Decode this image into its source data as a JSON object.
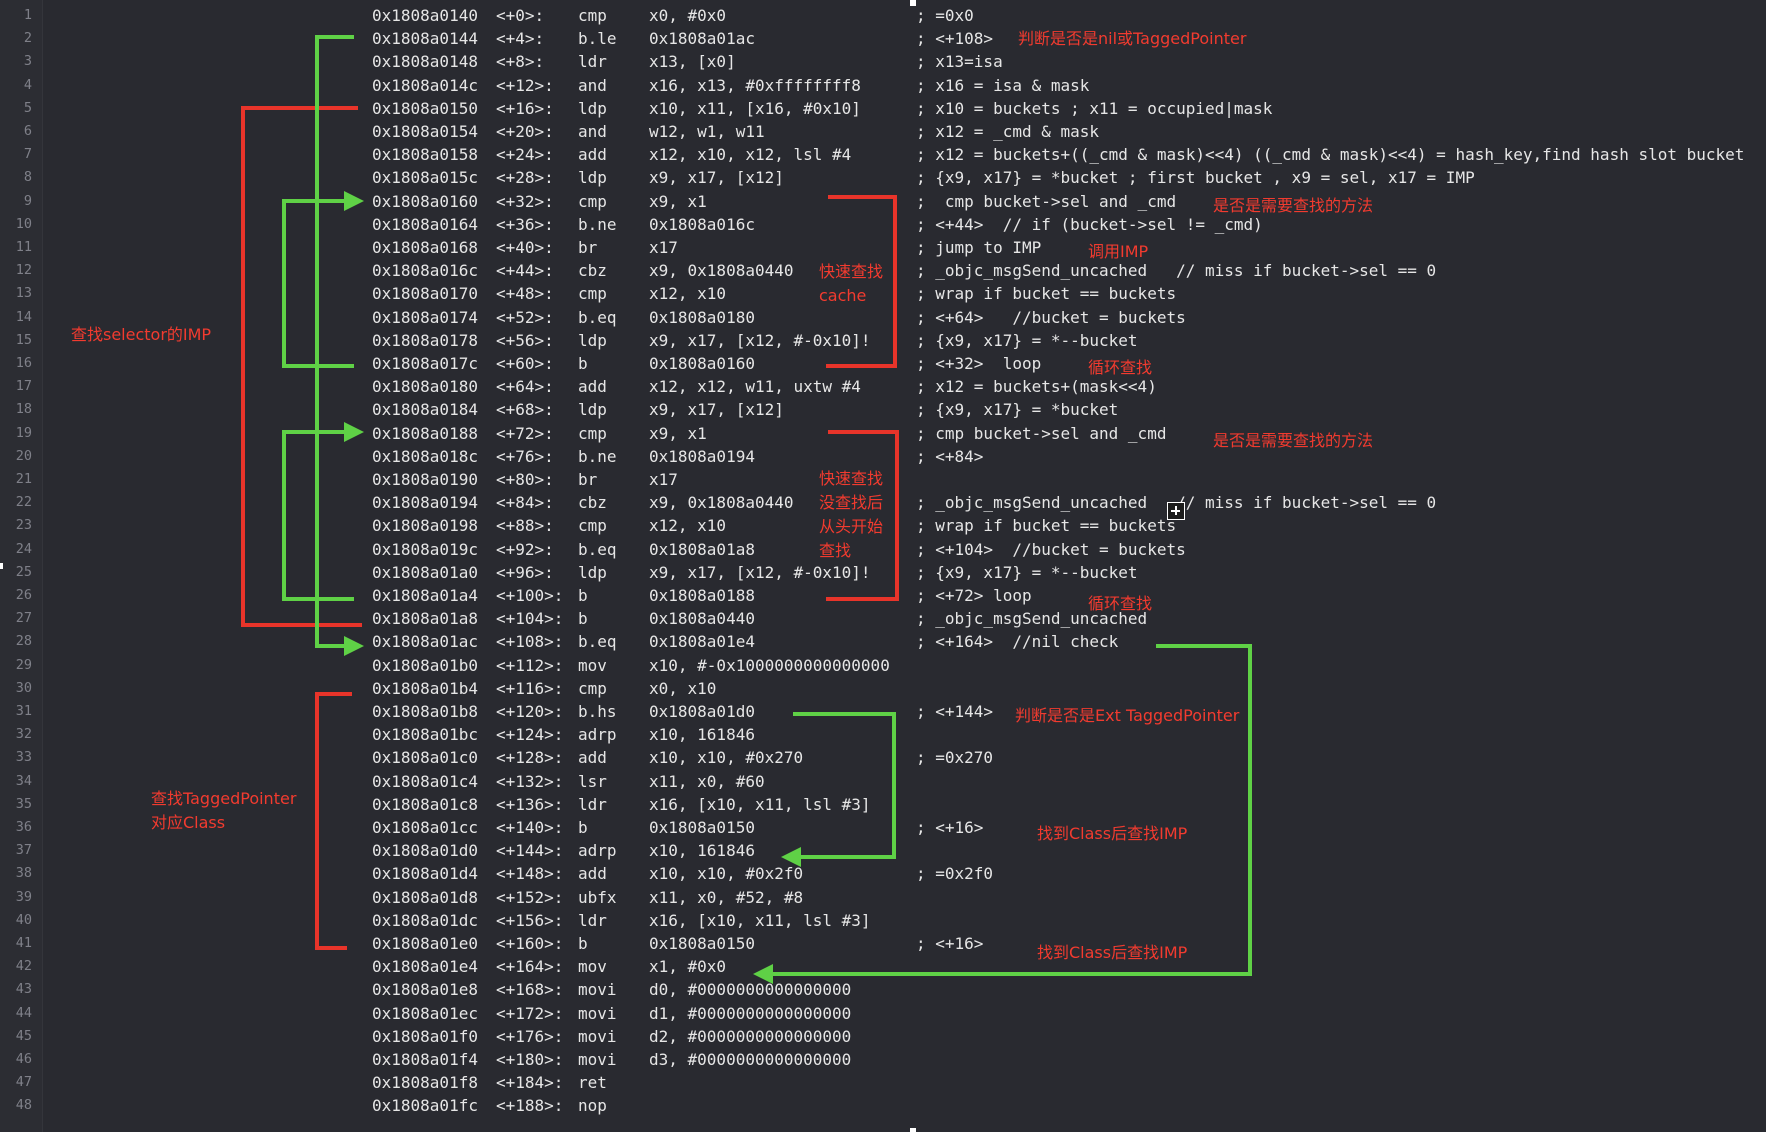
{
  "lines": [
    {
      "n": "1",
      "addr": "0x1808a0140",
      "off": "<+0>:",
      "op": "cmp",
      "args": "x0, #0x0",
      "cmt": "; =0x0"
    },
    {
      "n": "2",
      "addr": "0x1808a0144",
      "off": "<+4>:",
      "op": "b.le",
      "args": "0x1808a01ac",
      "cmt": "; <+108>"
    },
    {
      "n": "3",
      "addr": "0x1808a0148",
      "off": "<+8>:",
      "op": "ldr",
      "args": "x13, [x0]",
      "cmt": "; x13=isa"
    },
    {
      "n": "4",
      "addr": "0x1808a014c",
      "off": "<+12>:",
      "op": "and",
      "args": "x16, x13, #0xffffffff8",
      "cmt": "; x16 = isa & mask"
    },
    {
      "n": "5",
      "addr": "0x1808a0150",
      "off": "<+16>:",
      "op": "ldp",
      "args": "x10, x11, [x16, #0x10]",
      "cmt": "; x10 = buckets ; x11 = occupied|mask"
    },
    {
      "n": "6",
      "addr": "0x1808a0154",
      "off": "<+20>:",
      "op": "and",
      "args": "w12, w1, w11",
      "cmt": "; x12 = _cmd & mask"
    },
    {
      "n": "7",
      "addr": "0x1808a0158",
      "off": "<+24>:",
      "op": "add",
      "args": "x12, x10, x12, lsl #4",
      "cmt": "; x12 = buckets+((_cmd & mask)<<4) ((_cmd & mask)<<4) = hash_key,find hash slot bucket"
    },
    {
      "n": "8",
      "addr": "0x1808a015c",
      "off": "<+28>:",
      "op": "ldp",
      "args": "x9, x17, [x12]",
      "cmt": "; {x9, x17} = *bucket ; first bucket , x9 = sel, x17 = IMP"
    },
    {
      "n": "9",
      "addr": "0x1808a0160",
      "off": "<+32>:",
      "op": "cmp",
      "args": "x9, x1",
      "cmt": ";  cmp bucket->sel and _cmd"
    },
    {
      "n": "10",
      "addr": "0x1808a0164",
      "off": "<+36>:",
      "op": "b.ne",
      "args": "0x1808a016c",
      "cmt": "; <+44>  // if (bucket->sel != _cmd)"
    },
    {
      "n": "11",
      "addr": "0x1808a0168",
      "off": "<+40>:",
      "op": "br",
      "args": "x17",
      "cmt": "; jump to IMP"
    },
    {
      "n": "12",
      "addr": "0x1808a016c",
      "off": "<+44>:",
      "op": "cbz",
      "args": "x9, 0x1808a0440",
      "cmt": "; _objc_msgSend_uncached   // miss if bucket->sel == 0"
    },
    {
      "n": "13",
      "addr": "0x1808a0170",
      "off": "<+48>:",
      "op": "cmp",
      "args": "x12, x10",
      "cmt": "; wrap if bucket == buckets"
    },
    {
      "n": "14",
      "addr": "0x1808a0174",
      "off": "<+52>:",
      "op": "b.eq",
      "args": "0x1808a0180",
      "cmt": "; <+64>   //bucket = buckets"
    },
    {
      "n": "15",
      "addr": "0x1808a0178",
      "off": "<+56>:",
      "op": "ldp",
      "args": "x9, x17, [x12, #-0x10]!",
      "cmt": "; {x9, x17} = *--bucket"
    },
    {
      "n": "16",
      "addr": "0x1808a017c",
      "off": "<+60>:",
      "op": "b",
      "args": "0x1808a0160",
      "cmt": "; <+32>  loop"
    },
    {
      "n": "17",
      "addr": "0x1808a0180",
      "off": "<+64>:",
      "op": "add",
      "args": "x12, x12, w11, uxtw #4",
      "cmt": "; x12 = buckets+(mask<<4)"
    },
    {
      "n": "18",
      "addr": "0x1808a0184",
      "off": "<+68>:",
      "op": "ldp",
      "args": "x9, x17, [x12]",
      "cmt": "; {x9, x17} = *bucket"
    },
    {
      "n": "19",
      "addr": "0x1808a0188",
      "off": "<+72>:",
      "op": "cmp",
      "args": "x9, x1",
      "cmt": "; cmp bucket->sel and _cmd"
    },
    {
      "n": "20",
      "addr": "0x1808a018c",
      "off": "<+76>:",
      "op": "b.ne",
      "args": "0x1808a0194",
      "cmt": "; <+84>"
    },
    {
      "n": "21",
      "addr": "0x1808a0190",
      "off": "<+80>:",
      "op": "br",
      "args": "x17",
      "cmt": ""
    },
    {
      "n": "22",
      "addr": "0x1808a0194",
      "off": "<+84>:",
      "op": "cbz",
      "args": "x9, 0x1808a0440",
      "cmt": "; _objc_msgSend_uncached   // miss if bucket->sel == 0"
    },
    {
      "n": "23",
      "addr": "0x1808a0198",
      "off": "<+88>:",
      "op": "cmp",
      "args": "x12, x10",
      "cmt": "; wrap if bucket == buckets"
    },
    {
      "n": "24",
      "addr": "0x1808a019c",
      "off": "<+92>:",
      "op": "b.eq",
      "args": "0x1808a01a8",
      "cmt": "; <+104>  //bucket = buckets"
    },
    {
      "n": "25",
      "addr": "0x1808a01a0",
      "off": "<+96>:",
      "op": "ldp",
      "args": "x9, x17, [x12, #-0x10]!",
      "cmt": "; {x9, x17} = *--bucket"
    },
    {
      "n": "26",
      "addr": "0x1808a01a4",
      "off": "<+100>:",
      "op": "b",
      "args": "0x1808a0188",
      "cmt": "; <+72> loop"
    },
    {
      "n": "27",
      "addr": "0x1808a01a8",
      "off": "<+104>:",
      "op": "b",
      "args": "0x1808a0440",
      "cmt": "; _objc_msgSend_uncached"
    },
    {
      "n": "28",
      "addr": "0x1808a01ac",
      "off": "<+108>:",
      "op": "b.eq",
      "args": "0x1808a01e4",
      "cmt": "; <+164>  //nil check"
    },
    {
      "n": "29",
      "addr": "0x1808a01b0",
      "off": "<+112>:",
      "op": "mov",
      "args": "x10, #-0x1000000000000000",
      "cmt": ""
    },
    {
      "n": "30",
      "addr": "0x1808a01b4",
      "off": "<+116>:",
      "op": "cmp",
      "args": "x0, x10",
      "cmt": ""
    },
    {
      "n": "31",
      "addr": "0x1808a01b8",
      "off": "<+120>:",
      "op": "b.hs",
      "args": "0x1808a01d0",
      "cmt": "; <+144>"
    },
    {
      "n": "32",
      "addr": "0x1808a01bc",
      "off": "<+124>:",
      "op": "adrp",
      "args": "x10, 161846",
      "cmt": ""
    },
    {
      "n": "33",
      "addr": "0x1808a01c0",
      "off": "<+128>:",
      "op": "add",
      "args": "x10, x10, #0x270",
      "cmt": "; =0x270"
    },
    {
      "n": "34",
      "addr": "0x1808a01c4",
      "off": "<+132>:",
      "op": "lsr",
      "args": "x11, x0, #60",
      "cmt": ""
    },
    {
      "n": "35",
      "addr": "0x1808a01c8",
      "off": "<+136>:",
      "op": "ldr",
      "args": "x16, [x10, x11, lsl #3]",
      "cmt": ""
    },
    {
      "n": "36",
      "addr": "0x1808a01cc",
      "off": "<+140>:",
      "op": "b",
      "args": "0x1808a0150",
      "cmt": "; <+16>"
    },
    {
      "n": "37",
      "addr": "0x1808a01d0",
      "off": "<+144>:",
      "op": "adrp",
      "args": "x10, 161846",
      "cmt": ""
    },
    {
      "n": "38",
      "addr": "0x1808a01d4",
      "off": "<+148>:",
      "op": "add",
      "args": "x10, x10, #0x2f0",
      "cmt": "; =0x2f0"
    },
    {
      "n": "39",
      "addr": "0x1808a01d8",
      "off": "<+152>:",
      "op": "ubfx",
      "args": "x11, x0, #52, #8",
      "cmt": ""
    },
    {
      "n": "40",
      "addr": "0x1808a01dc",
      "off": "<+156>:",
      "op": "ldr",
      "args": "x16, [x10, x11, lsl #3]",
      "cmt": ""
    },
    {
      "n": "41",
      "addr": "0x1808a01e0",
      "off": "<+160>:",
      "op": "b",
      "args": "0x1808a0150",
      "cmt": "; <+16>"
    },
    {
      "n": "42",
      "addr": "0x1808a01e4",
      "off": "<+164>:",
      "op": "mov",
      "args": "x1, #0x0",
      "cmt": ""
    },
    {
      "n": "43",
      "addr": "0x1808a01e8",
      "off": "<+168>:",
      "op": "movi",
      "args": "d0, #0000000000000000",
      "cmt": ""
    },
    {
      "n": "44",
      "addr": "0x1808a01ec",
      "off": "<+172>:",
      "op": "movi",
      "args": "d1, #0000000000000000",
      "cmt": ""
    },
    {
      "n": "45",
      "addr": "0x1808a01f0",
      "off": "<+176>:",
      "op": "movi",
      "args": "d2, #0000000000000000",
      "cmt": ""
    },
    {
      "n": "46",
      "addr": "0x1808a01f4",
      "off": "<+180>:",
      "op": "movi",
      "args": "d3, #0000000000000000",
      "cmt": ""
    },
    {
      "n": "47",
      "addr": "0x1808a01f8",
      "off": "<+184>:",
      "op": "ret",
      "args": "",
      "cmt": ""
    },
    {
      "n": "48",
      "addr": "0x1808a01fc",
      "off": "<+188>:",
      "op": "nop",
      "args": "",
      "cmt": ""
    }
  ],
  "annotations": {
    "nil_tagged_check": "判断是否是nil或TaggedPointer",
    "is_target_method_1": "是否是需要查找的方法",
    "call_imp": "调用IMP",
    "fast_cache_lookup": "快速查找\ncache",
    "loop_lookup_1": "循环查找",
    "find_selector_imp": "查找selector的IMP",
    "is_target_method_2": "是否是需要查找的方法",
    "fast_lookup_restart": "快速查找\n没查找后\n从头开始\n查找",
    "loop_lookup_2": "循环查找",
    "ext_tagged_check": "判断是否是Ext TaggedPointer",
    "find_tagged_class": "查找TaggedPointer\n对应Class",
    "found_class_find_imp_1": "找到Class后查找IMP",
    "found_class_find_imp_2": "找到Class后查找IMP"
  },
  "colors": {
    "background": "#292a30",
    "text": "#e6e6e6",
    "line_number": "#7f8089",
    "annotation_red": "#f23b2f",
    "arrow_green": "#5fd146",
    "bracket_red": "#e8342a"
  }
}
